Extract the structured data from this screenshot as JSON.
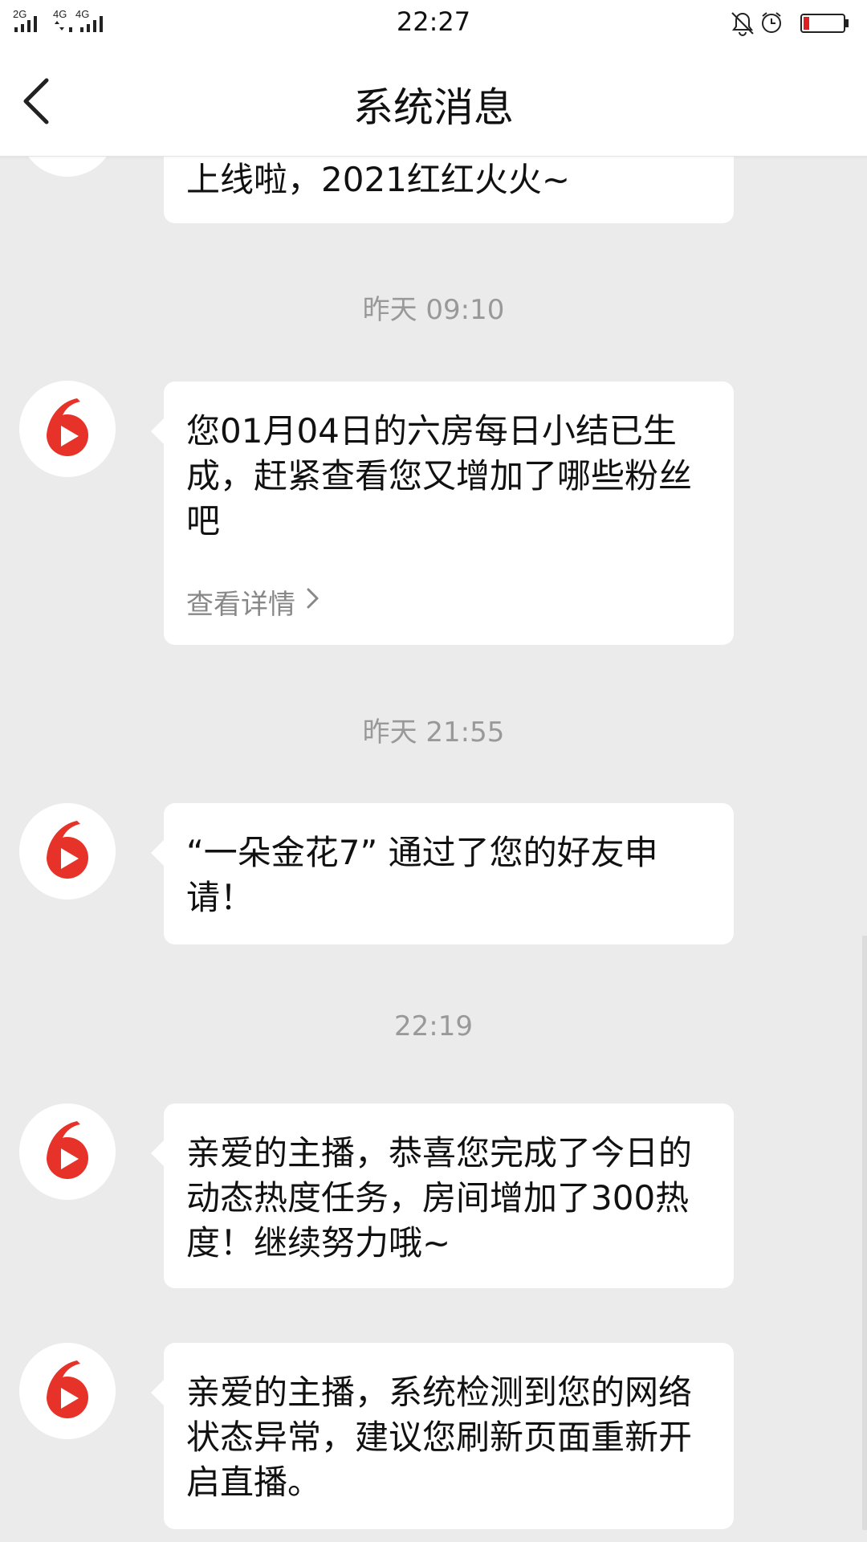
{
  "status_bar": {
    "signal_1": "2G",
    "signal_2": "4G",
    "signal_3": "4G",
    "time": "22:27",
    "icons": [
      "bell-off-icon",
      "alarm-icon",
      "battery-low-icon"
    ],
    "battery_color": "#e02020"
  },
  "nav": {
    "title": "系统消息",
    "back_icon": "chevron-left-icon"
  },
  "brand": {
    "accent": "#e63229"
  },
  "partial_message": {
    "text": "上线啦，2021红红火火~"
  },
  "messages": [
    {
      "timestamp": "昨天 09:10",
      "text": "您01月04日的六房每日小结已生成，赶紧查看您又增加了哪些粉丝吧",
      "link": "查看详情"
    },
    {
      "timestamp": "昨天 21:55",
      "text": "“一朵金花7” 通过了您的好友申请！"
    },
    {
      "timestamp": "22:19",
      "text": "亲爱的主播，恭喜您完成了今日的动态热度任务，房间增加了300热度！继续努力哦~"
    },
    {
      "text": "亲爱的主播，系统检测到您的网络状态异常，建议您刷新页面重新开启直播。"
    }
  ]
}
